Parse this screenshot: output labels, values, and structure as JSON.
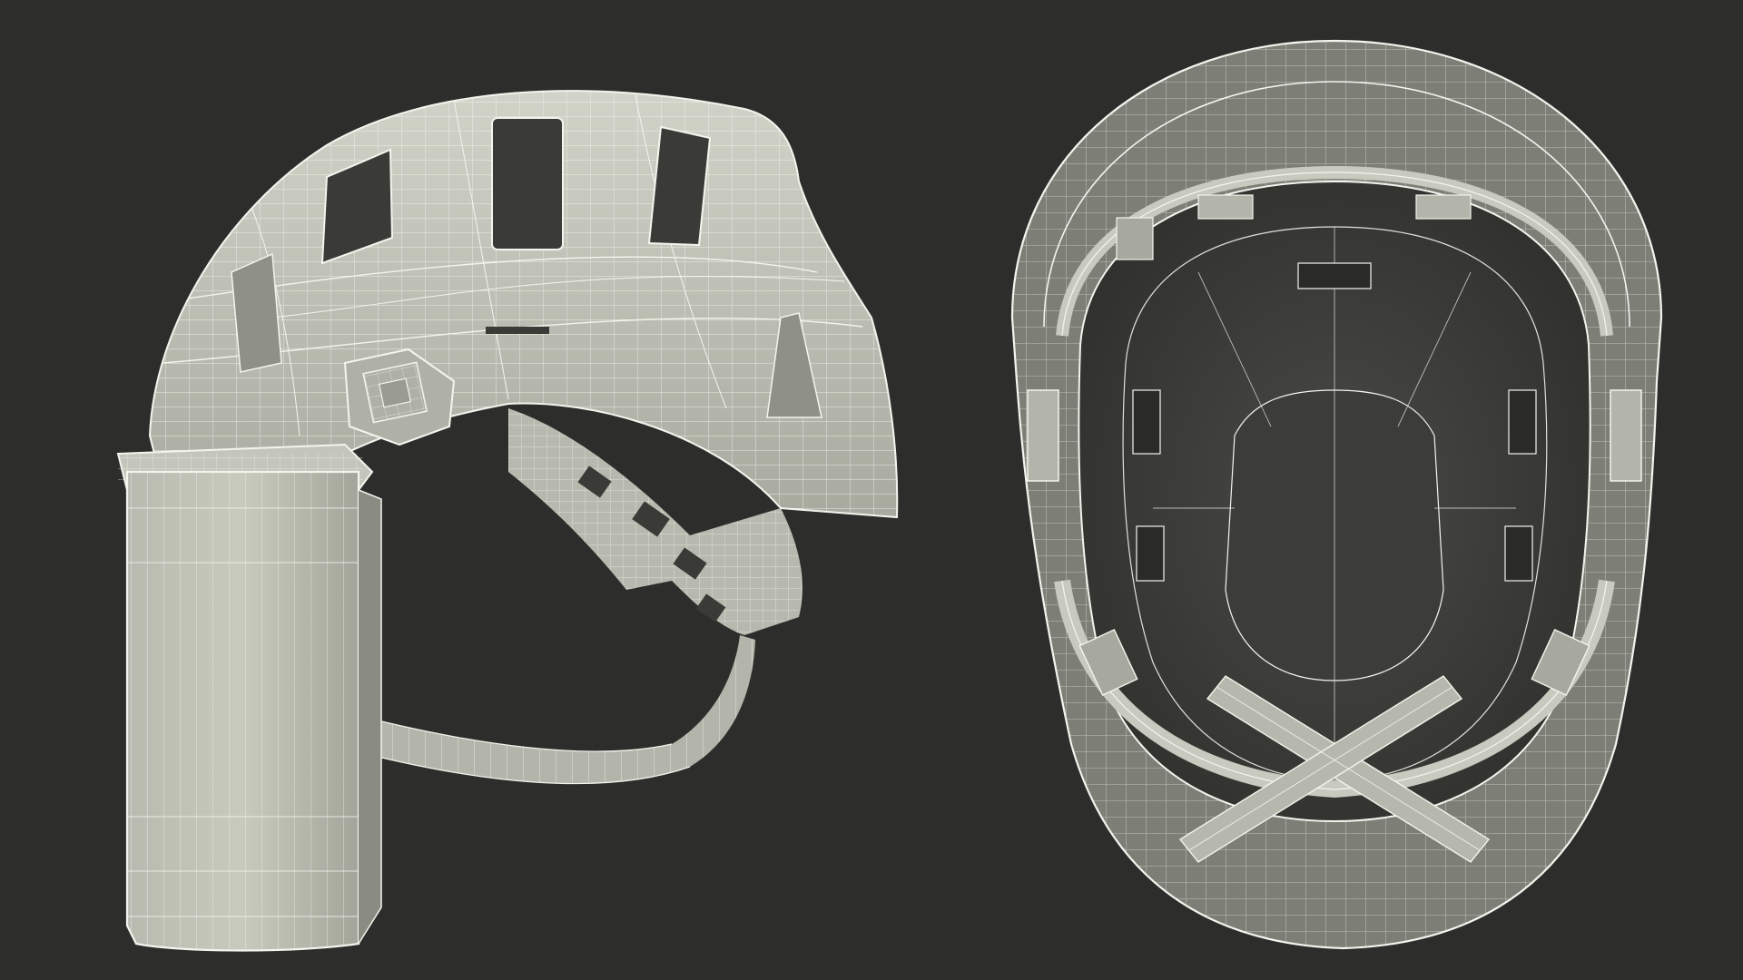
{
  "scene": {
    "background": "#2d2d2b",
    "surface_color": "#c7c8bd",
    "shade_color": "#9c9d93",
    "dark_color": "#3a3b37",
    "wire_color": "#f4f4ee",
    "views": [
      {
        "id": "side",
        "subject": "helmet-with-face-shield",
        "orientation": "side"
      },
      {
        "id": "bottom",
        "subject": "helmet-interior",
        "orientation": "bottom"
      }
    ]
  }
}
